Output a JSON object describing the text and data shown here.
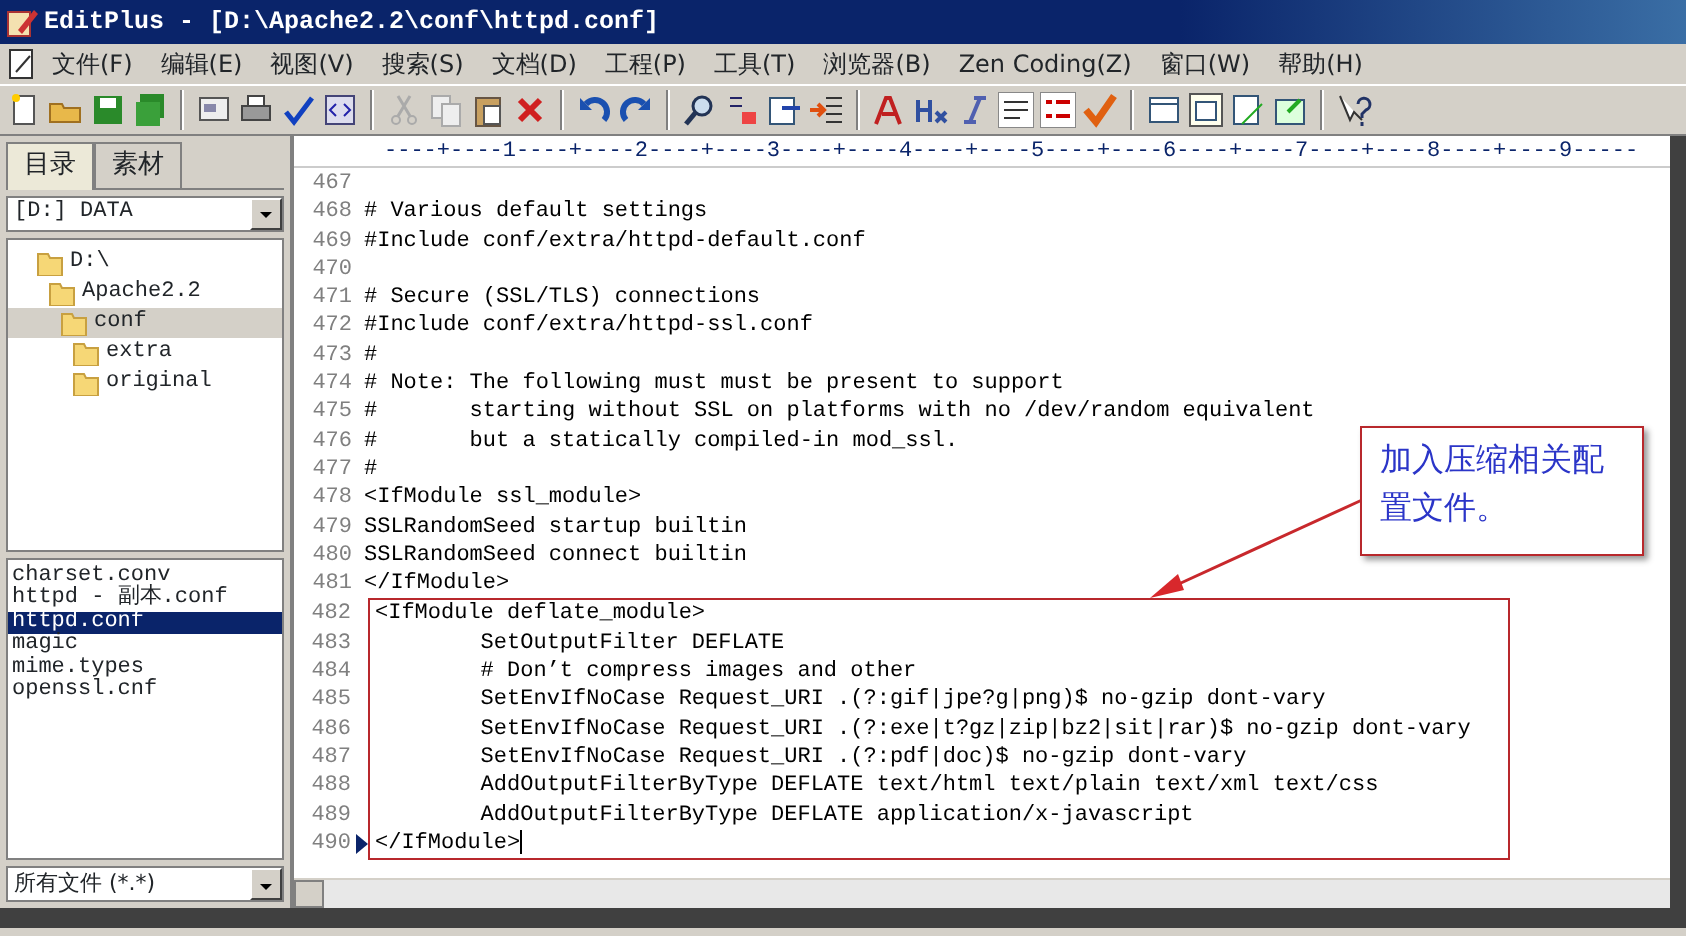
{
  "window": {
    "title": "EditPlus - [D:\\Apache2.2\\conf\\httpd.conf]"
  },
  "menu": [
    "文件(F)",
    "编辑(E)",
    "视图(V)",
    "搜索(S)",
    "文档(D)",
    "工程(P)",
    "工具(T)",
    "浏览器(B)",
    "Zen Coding(Z)",
    "窗口(W)",
    "帮助(H)"
  ],
  "sidebar": {
    "tabs": [
      {
        "label": "目录",
        "selected": true
      },
      {
        "label": "素材",
        "selected": false
      }
    ],
    "drive": "[D:] DATA",
    "tree": [
      {
        "label": "D:\\",
        "selected": false,
        "children": [
          {
            "label": "Apache2.2",
            "selected": false,
            "children": [
              {
                "label": "conf",
                "selected": true,
                "children": [
                  {
                    "label": "extra",
                    "selected": false
                  },
                  {
                    "label": "original",
                    "selected": false
                  }
                ]
              }
            ]
          }
        ]
      }
    ],
    "files": [
      {
        "label": "charset.conv",
        "selected": false
      },
      {
        "label": "httpd - 副本.conf",
        "selected": false
      },
      {
        "label": "httpd.conf",
        "selected": true
      },
      {
        "label": "magic",
        "selected": false
      },
      {
        "label": "mime.types",
        "selected": false
      },
      {
        "label": "openssl.cnf",
        "selected": false
      }
    ],
    "filter": "所有文件 (*.*)"
  },
  "editor": {
    "ruler": "----+----1----+----2----+----3----+----4----+----5----+----6----+----7----+----8----+----9-----",
    "lines": [
      {
        "number": "467",
        "boxed": false,
        "current": false
      },
      {
        "number": "468",
        "text": "# Various default settings",
        "boxed": false,
        "current": false
      },
      {
        "number": "469",
        "text": "#Include conf/extra/httpd-default.conf",
        "boxed": false,
        "current": false
      },
      {
        "number": "470",
        "boxed": false,
        "current": false
      },
      {
        "number": "471",
        "text": "# Secure (SSL/TLS) connections",
        "boxed": false,
        "current": false
      },
      {
        "number": "472",
        "text": "#Include conf/extra/httpd-ssl.conf",
        "boxed": false,
        "current": false
      },
      {
        "number": "473",
        "text": "#",
        "boxed": false,
        "current": false
      },
      {
        "number": "474",
        "text": "# Note: The following must must be present to support",
        "boxed": false,
        "current": false
      },
      {
        "number": "475",
        "text": "#       starting without SSL on platforms with no /dev/random equivalent",
        "boxed": false,
        "current": false
      },
      {
        "number": "476",
        "text": "#       but a statically compiled-in mod_ssl.",
        "boxed": false,
        "current": false
      },
      {
        "number": "477",
        "text": "#",
        "boxed": false,
        "current": false
      },
      {
        "number": "478",
        "text": "<IfModule ssl_module>",
        "boxed": false,
        "current": false
      },
      {
        "number": "479",
        "text": "SSLRandomSeed startup builtin",
        "boxed": false,
        "current": false
      },
      {
        "number": "480",
        "text": "SSLRandomSeed connect builtin",
        "boxed": false,
        "current": false
      },
      {
        "number": "481",
        "text": "</IfModule>",
        "boxed": false,
        "current": false
      },
      {
        "number": "482",
        "text": "<IfModule deflate_module>",
        "boxed": true,
        "current": false
      },
      {
        "number": "483",
        "text": "        SetOutputFilter DEFLATE",
        "boxed": true,
        "current": false
      },
      {
        "number": "484",
        "text": "        # Don’t compress images and other",
        "boxed": true,
        "current": false
      },
      {
        "number": "485",
        "text": "        SetEnvIfNoCase Request_URI .(?:gif|jpe?g|png)$ no-gzip dont-vary",
        "boxed": true,
        "current": false
      },
      {
        "number": "486",
        "text": "        SetEnvIfNoCase Request_URI .(?:exe|t?gz|zip|bz2|sit|rar)$ no-gzip dont-vary",
        "boxed": true,
        "current": false
      },
      {
        "number": "487",
        "text": "        SetEnvIfNoCase Request_URI .(?:pdf|doc)$ no-gzip dont-vary",
        "boxed": true,
        "current": false
      },
      {
        "number": "488",
        "text": "        AddOutputFilterByType DEFLATE text/html text/plain text/xml text/css",
        "boxed": true,
        "current": false
      },
      {
        "number": "489",
        "text": "        AddOutputFilterByType DEFLATE application/x-javascript",
        "boxed": true,
        "current": false
      },
      {
        "number": "490",
        "text": "</IfModule>",
        "boxed": true,
        "current": true
      }
    ]
  },
  "annotation": {
    "text": "加入压缩相关配置文件。"
  }
}
